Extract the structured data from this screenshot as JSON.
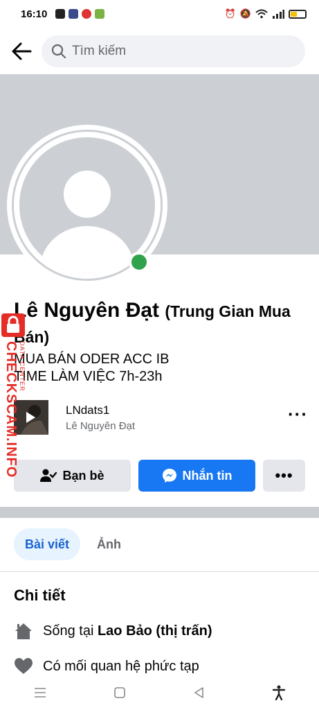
{
  "status_bar": {
    "time": "16:10"
  },
  "search": {
    "placeholder": "Tìm kiếm"
  },
  "profile": {
    "name": "Lê Nguyên Đạt",
    "alt_name": "(Trung Gian Mua Bán)",
    "bio_line1": "MUA BÁN ODER ACC IB",
    "bio_line2": "TIME LÀM VIỆC 7h-23h"
  },
  "linked_account": {
    "username": "LNdats1",
    "display_name": "Lê Nguyên Đạt"
  },
  "actions": {
    "friends_label": "Bạn bè",
    "message_label": "Nhắn tin",
    "more_label": "•••"
  },
  "tabs": [
    {
      "label": "Bài viết",
      "active": true
    },
    {
      "label": "Ảnh",
      "active": false
    }
  ],
  "details": {
    "title": "Chi tiết",
    "lives_prefix": "Sống tại ",
    "lives_place": "Lao Bảo (thị trấn)",
    "relationship": "Có mối quan hệ phức tạp"
  },
  "watermark": {
    "text": "CHECKSCAM.INFO",
    "sub": "DATA CENTER"
  },
  "colors": {
    "accent": "#1877f2",
    "online": "#31a24c",
    "watermark": "#e52d27"
  }
}
